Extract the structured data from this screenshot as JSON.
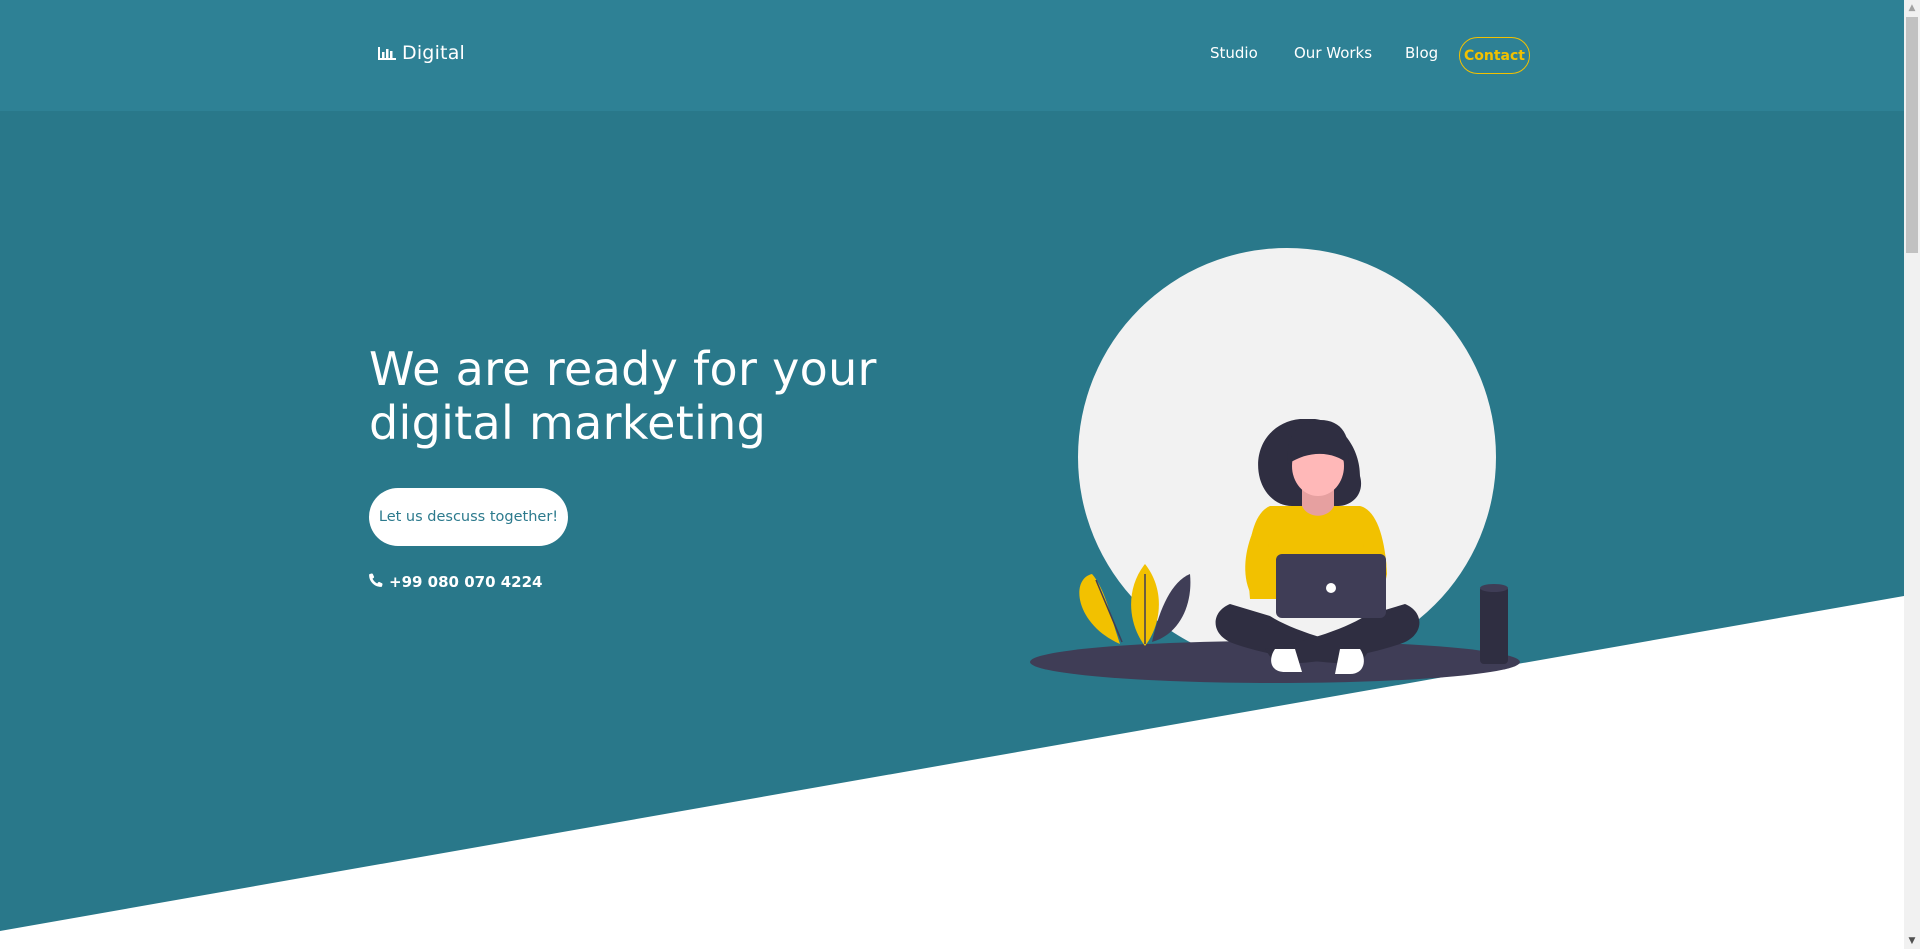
{
  "brand": {
    "name": "Digital",
    "icon": "bar-chart-icon"
  },
  "nav": {
    "items": [
      {
        "label": "Studio"
      },
      {
        "label": "Our Works"
      },
      {
        "label": "Blog"
      }
    ],
    "contact_label": "Contact"
  },
  "hero": {
    "headline": "We are ready for your digital marketing",
    "cta_label": "Let us descuss together!",
    "phone": "+99 080 070 4224",
    "phone_icon": "phone-icon"
  },
  "illustration": {
    "subject": "woman-with-laptop-illustration"
  },
  "colors": {
    "header_bg": "#2e8195",
    "hero_bg": "#29788a",
    "accent_yellow": "#f2c100",
    "button_bg": "#ffffff",
    "button_text": "#2c7a8d"
  }
}
